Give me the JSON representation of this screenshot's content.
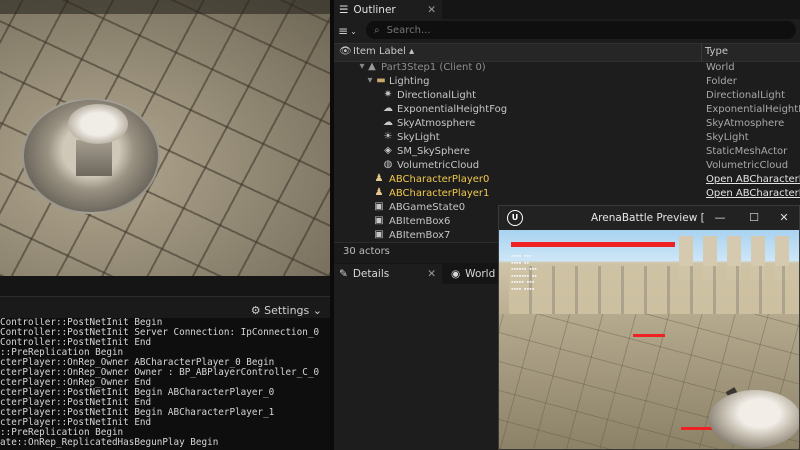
{
  "outliner": {
    "tab_label": "Outliner",
    "search_placeholder": "Search...",
    "col_label": "Item Label",
    "col_type": "Type",
    "rows": [
      {
        "label": "Part3Step1 (Client 0)",
        "type": "World",
        "icon": "world-icon"
      },
      {
        "label": "Lighting",
        "type": "Folder",
        "icon": "folder-icon"
      },
      {
        "label": "DirectionalLight",
        "type": "DirectionalLight",
        "icon": "sun-icon"
      },
      {
        "label": "ExponentialHeightFog",
        "type": "ExponentialHeightFog",
        "icon": "fog-icon"
      },
      {
        "label": "SkyAtmosphere",
        "type": "SkyAtmosphere",
        "icon": "atmosphere-icon"
      },
      {
        "label": "SkyLight",
        "type": "SkyLight",
        "icon": "skylight-icon"
      },
      {
        "label": "SM_SkySphere",
        "type": "StaticMeshActor",
        "icon": "static-mesh-icon"
      },
      {
        "label": "VolumetricCloud",
        "type": "VolumetricCloud",
        "icon": "cloud-icon"
      },
      {
        "label": "ABCharacterPlayer0",
        "type": "Open ABCharacterPlay",
        "icon": "pawn-icon"
      },
      {
        "label": "ABCharacterPlayer1",
        "type": "Open ABCharacterPlay",
        "icon": "pawn-icon"
      },
      {
        "label": "ABGameState0",
        "type": "",
        "icon": "actor-icon"
      },
      {
        "label": "ABItemBox6",
        "type": "",
        "icon": "actor-icon"
      },
      {
        "label": "ABItemBox7",
        "type": "",
        "icon": "actor-icon"
      }
    ],
    "actor_count": "30 actors"
  },
  "log": {
    "settings_label": "Settings",
    "lines": [
      "Controller::PostNetInit Begin",
      "Controller::PostNetInit Server Connection: IpConnection_0",
      "Controller::PostNetInit End",
      "::PreReplication Begin",
      "cterPlayer::OnRep_Owner ABCharacterPlayer_0 Begin",
      "cterPlayer::OnRep_Owner Owner : BP_ABPlayerController_C_0",
      "cterPlayer::OnRep_Owner End",
      "cterPlayer::PostNetInit Begin ABCharacterPlayer_0",
      "cterPlayer::PostNetInit End",
      "cterPlayer::PostNetInit Begin ABCharacterPlayer_1",
      "cterPlayer::PostNetInit End",
      "::PreReplication Begin",
      "ate::OnRep_ReplicatedHasBegunPlay Begin"
    ]
  },
  "bottom_tabs": {
    "details_label": "Details",
    "world_label": "World S"
  },
  "preview": {
    "title": "ArenaBattle Preview [NetMode",
    "player_hp_fraction": 0.9,
    "enemy_hp_fraction": 1.0
  },
  "colors": {
    "highlight": "#f2c94c",
    "hp_bar": "#e22222",
    "panel_bg": "#1d1d1d"
  }
}
